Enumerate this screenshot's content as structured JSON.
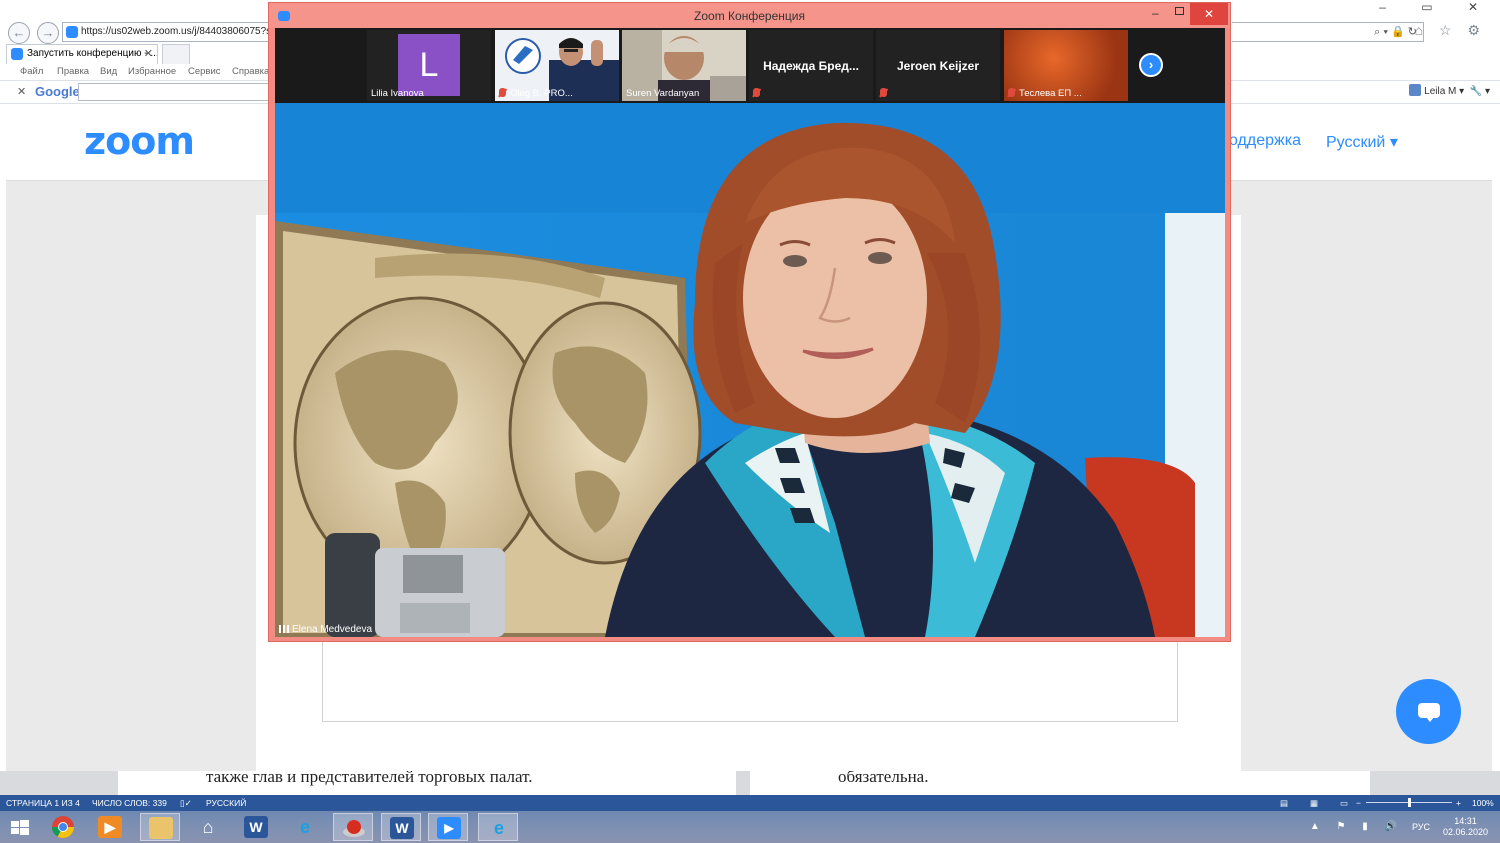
{
  "browser": {
    "url": "https://us02web.zoom.us/j/84403806075?statu",
    "tab_title": "Запустить конференцию - ...",
    "tab_close": "✕",
    "menu": [
      "Файл",
      "Правка",
      "Вид",
      "Избранное",
      "Сервис",
      "Справка"
    ],
    "addr_right_icons": "⌕ ▾ 🔒 ↻",
    "toolbar_icons": "⌂ ☆ ⚙",
    "window_controls": "– ▭ ✕",
    "google_close": "✕",
    "google_label": "Google",
    "user_label": "Leila M ▾",
    "user_tools": "🔧 ▾"
  },
  "zoom_page": {
    "logo": "zoom",
    "support_link": "оддержка",
    "language": "Русский ▾"
  },
  "meeting": {
    "window_title": "Zoom Конференция",
    "min": "–",
    "close": "✕",
    "participants": [
      {
        "name": "Lilia Ivanova",
        "avatar_letter": "L",
        "muted": false
      },
      {
        "name": "Oleg B. PRO...",
        "muted": true
      },
      {
        "name": "Suren Vardanyan",
        "muted": false
      },
      {
        "name": "Надежда  Бред...",
        "muted": true
      },
      {
        "name": "Jeroen Keijzer",
        "muted": true
      },
      {
        "name": "Теслева ЕП ...",
        "muted": true
      }
    ],
    "next_icon": "›",
    "active_speaker": "Elena Medvedeva"
  },
  "word": {
    "page1_text": "также глав и представителей торговых палат.",
    "page2_text": "обязательна.",
    "status_page": "СТРАНИЦА 1 ИЗ 4",
    "status_words": "ЧИСЛО СЛОВ: 339",
    "status_lang": "РУССКИЙ",
    "zoom_minus": "−",
    "zoom_plus": "+",
    "zoom_level": "100%"
  },
  "taskbar": {
    "time": "14:31",
    "date": "02.06.2020",
    "lang": "РУС",
    "apps": [
      "windows-start",
      "chrome",
      "media-player",
      "file-explorer",
      "home",
      "word",
      "internet-explorer",
      "red-button-app",
      "word",
      "zoom",
      "internet-explorer"
    ],
    "tray_icons": "▲ ⚑ ▮ 🔊"
  },
  "colors": {
    "zoom_blue": "#2d8cff",
    "window_border": "#f28b82",
    "word_blue": "#2b579a"
  }
}
